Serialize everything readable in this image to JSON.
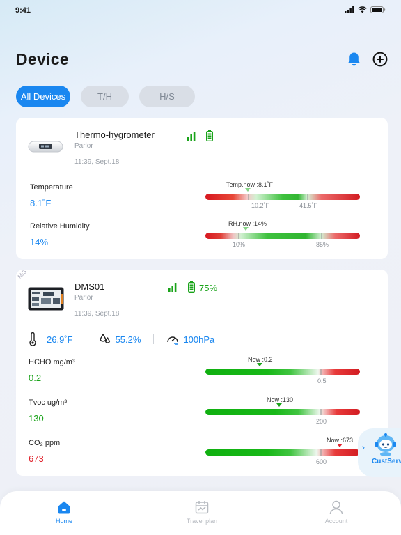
{
  "status": {
    "time": "9:41"
  },
  "header": {
    "title": "Device"
  },
  "filters": [
    {
      "label": "All Devices"
    },
    {
      "label": "T/H"
    },
    {
      "label": "H/S"
    }
  ],
  "device1": {
    "name": "Thermo-hygrometer",
    "location": "Parlor",
    "time": "11:39, Sept.18",
    "metrics": [
      {
        "label": "Temperature",
        "value": "8.1˚F",
        "now": "Temp.now :8.1˚F",
        "min": "10.2˚F",
        "max": "41.5˚F"
      },
      {
        "label": "Relative Humidity",
        "value": "14%",
        "now": "RH.now :14%",
        "min": "10%",
        "max": "85%"
      }
    ]
  },
  "device2": {
    "tag": "M/S",
    "name": "DMS01",
    "location": "Parlor",
    "time": "11:39, Sept.18",
    "battery": "75%",
    "env": {
      "temp": "26.9˚F",
      "humidity": "55.2%",
      "pressure": "100hPa"
    },
    "metrics": [
      {
        "label": "HCHO mg/m³",
        "value": "0.2",
        "now": "Now :0.2",
        "limit": "0.5"
      },
      {
        "label": "Tvoc ug/m³",
        "value": "130",
        "now": "Now :130",
        "limit": "200"
      },
      {
        "label": "CO₂ ppm",
        "value": "673",
        "now": "Now :673",
        "limit": "600"
      }
    ]
  },
  "cust": {
    "label": "CustServ"
  },
  "tabbar": [
    {
      "label": "Home"
    },
    {
      "label": "Travel plan"
    },
    {
      "label": "Account"
    }
  ]
}
